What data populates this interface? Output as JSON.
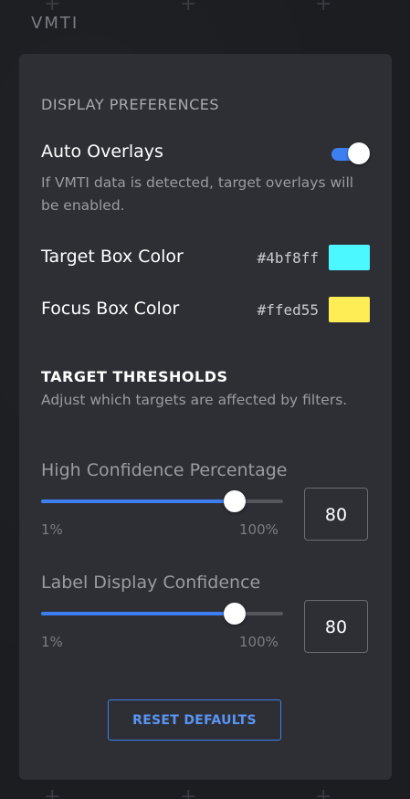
{
  "app": {
    "title": "VMTI"
  },
  "display_preferences": {
    "heading": "DISPLAY PREFERENCES",
    "auto_overlays": {
      "label": "Auto Overlays",
      "enabled": true,
      "description": "If VMTI data is detected, target overlays will be enabled."
    },
    "target_box": {
      "label": "Target Box Color",
      "hex": "#4bf8ff",
      "color": "#4bf8ff"
    },
    "focus_box": {
      "label": "Focus Box Color",
      "hex": "#ffed55",
      "color": "#ffed55"
    }
  },
  "target_thresholds": {
    "heading": "TARGET THRESHOLDS",
    "description": "Adjust which targets are affected by filters.",
    "high_confidence": {
      "label": "High Confidence Percentage",
      "min_label": "1%",
      "max_label": "100%",
      "value": "80",
      "fraction": 0.8
    },
    "label_display": {
      "label": "Label Display Confidence",
      "min_label": "1%",
      "max_label": "100%",
      "value": "80",
      "fraction": 0.8
    }
  },
  "actions": {
    "reset_label": "RESET DEFAULTS"
  },
  "colors": {
    "accent": "#3d7ff0",
    "panel": "#2e2f35",
    "background": "#1c1d21"
  }
}
